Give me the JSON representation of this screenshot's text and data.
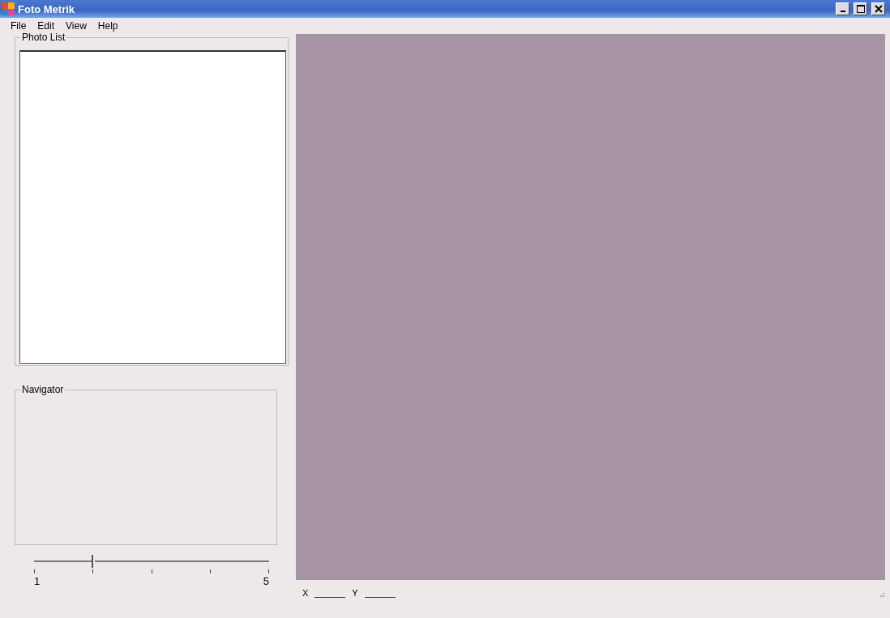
{
  "window": {
    "title": "Foto Metrik"
  },
  "menu": [
    {
      "label": "File"
    },
    {
      "label": "Edit"
    },
    {
      "label": "View"
    },
    {
      "label": "Help"
    }
  ],
  "photo_list": {
    "title": "Photo List"
  },
  "navigator": {
    "title": "Navigator"
  },
  "zoom_slider": {
    "level": 0.25,
    "min_label": "1",
    "max_label": "5"
  },
  "status_bar": {
    "x_label": "X",
    "y_label": "Y"
  }
}
